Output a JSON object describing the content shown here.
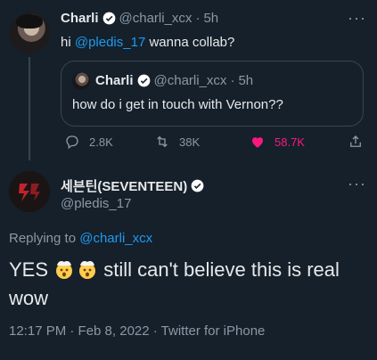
{
  "parent_tweet": {
    "author_name": "Charli",
    "author_handle": "@charli_xcx",
    "time": "5h",
    "text_prefix": "hi ",
    "mention": "@pledis_17",
    "text_suffix": " wanna collab?",
    "quoted": {
      "author_name": "Charli",
      "author_handle": "@charli_xcx",
      "time": "5h",
      "text": "how do i get in touch with Vernon??"
    },
    "actions": {
      "replies": "2.8K",
      "retweets": "38K",
      "likes": "58.7K"
    }
  },
  "main_tweet": {
    "author_name": "세븐틴(SEVENTEEN)",
    "author_handle": "@pledis_17",
    "replying_to_label": "Replying to ",
    "replying_to_handle": "@charli_xcx",
    "text_a": "YES ",
    "text_b": " still can't believe this is real",
    "text_c": "wow",
    "meta": "12:17 PM · Feb 8, 2022 · Twitter for iPhone"
  },
  "ui": {
    "more": "···",
    "dot": "·",
    "accent_color": "#1d9bf0",
    "like_color": "#f91880",
    "background": "#15202b"
  }
}
